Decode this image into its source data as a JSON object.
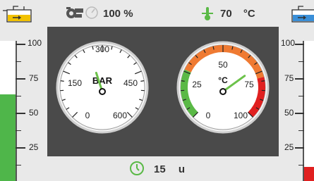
{
  "status_bar": {
    "pump_speed": "100 %",
    "temperature_value": "70",
    "temperature_unit": "°C"
  },
  "left_tank": {
    "scale": [
      "100",
      "75",
      "50",
      "25"
    ],
    "level_fraction": 0.62,
    "fill_color": "#4fb64a"
  },
  "right_tank": {
    "scale": [
      "100",
      "75",
      "50",
      "25"
    ],
    "level_fraction": 0.1,
    "fill_color": "#e02020"
  },
  "pressure_gauge": {
    "unit": "BAR",
    "ticks": [
      "0",
      "150",
      "300",
      "450",
      "600"
    ],
    "value": 260
  },
  "temperature_gauge": {
    "unit": "°C",
    "ticks": [
      "0",
      "25",
      "50",
      "75",
      "100"
    ],
    "value": 70
  },
  "timer": {
    "value": "15",
    "unit": "u"
  },
  "colors": {
    "panel": "#4a4a4a",
    "accent_green": "#5ab946",
    "warning_orange": "#ef7a32",
    "danger_red": "#e02020",
    "needle": "#6cc24a"
  }
}
